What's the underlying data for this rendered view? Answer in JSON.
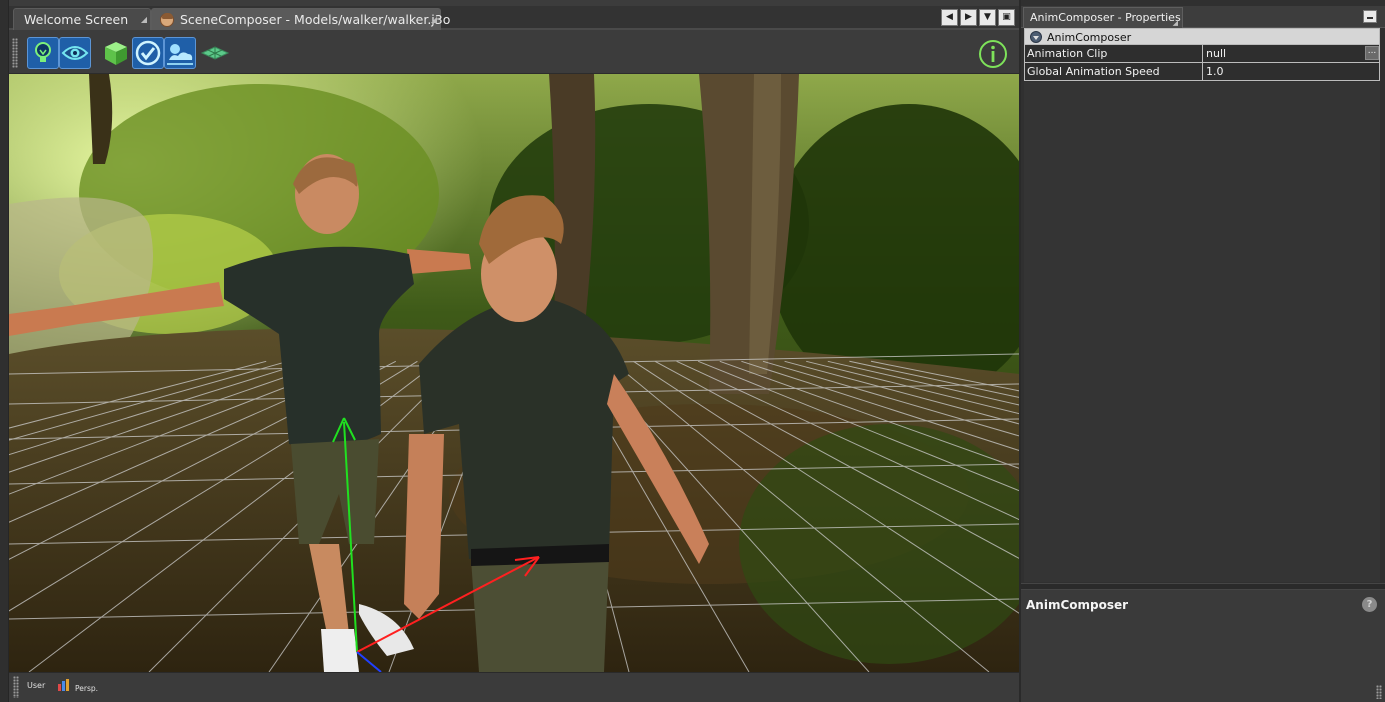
{
  "editor": {
    "tabs": [
      {
        "label": "Welcome Screen",
        "active": false
      },
      {
        "label": "SceneComposer - Models/walker/walker.j3o",
        "active": true
      }
    ],
    "tab_controls": [
      "scroll-left-icon",
      "scroll-right-icon",
      "dropdown-icon",
      "maximize-icon"
    ],
    "toolbar": {
      "tools": [
        {
          "name": "light-bulb-icon",
          "selected": true
        },
        {
          "name": "eye-icon",
          "selected": true
        },
        {
          "name": "cube-icon",
          "selected": false
        },
        {
          "name": "check-icon",
          "selected": true
        },
        {
          "name": "sky-icon",
          "selected": true
        },
        {
          "name": "grid-plane-icon",
          "selected": false
        }
      ],
      "info_icon": "info-icon"
    },
    "viewport": {
      "description_colors": {
        "grid": "#cfcfcf",
        "axis_x": "#ff2020",
        "axis_y": "#20e020",
        "axis_z": "#2040ff"
      }
    },
    "statusbar": {
      "view_label": "User",
      "projection_label": "Persp."
    }
  },
  "panel": {
    "tab_label": "AnimComposer - Properties",
    "category": "AnimComposer",
    "properties": [
      {
        "name": "Animation Clip",
        "value": "null"
      },
      {
        "name": "Global Animation Speed",
        "value": "1.0"
      }
    ],
    "more_button": "...",
    "description_title": "AnimComposer",
    "help_symbol": "?"
  }
}
